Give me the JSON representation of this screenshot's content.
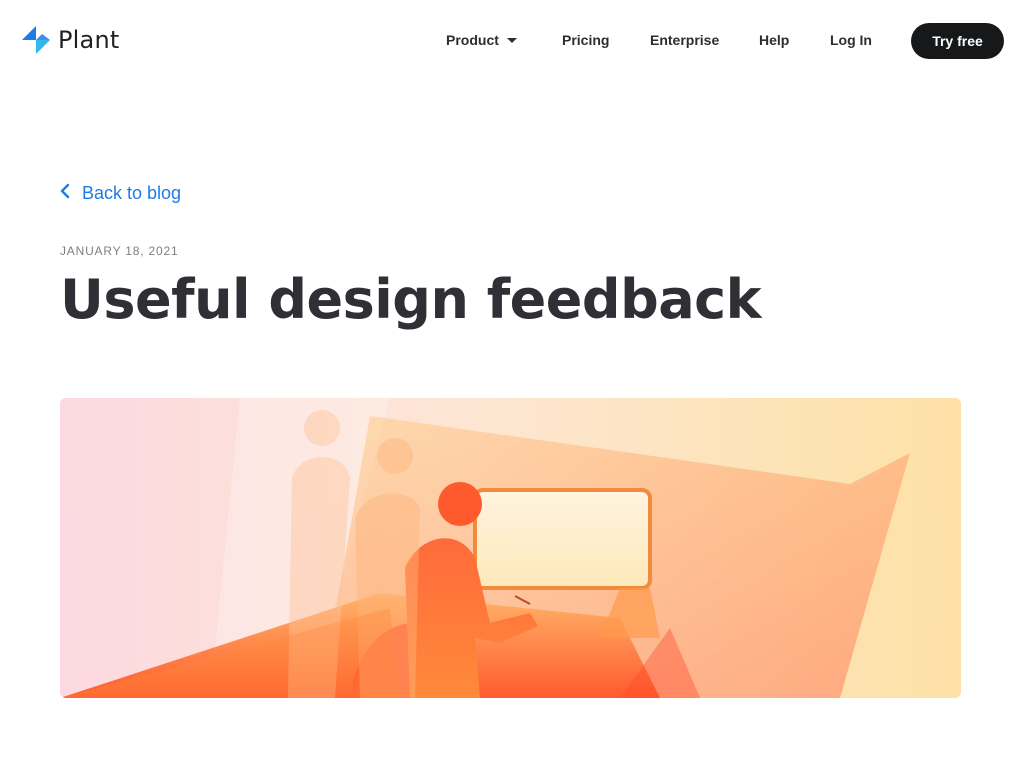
{
  "brand": {
    "name": "Plant",
    "accent": "#1f7be6",
    "logo_colors": [
      "#1f7be6",
      "#34b6f0"
    ]
  },
  "nav": {
    "items": [
      {
        "label": "Product",
        "has_dropdown": true
      },
      {
        "label": "Pricing"
      },
      {
        "label": "Enterprise"
      },
      {
        "label": "Help"
      },
      {
        "label": "Log In"
      }
    ],
    "cta_label": "Try free",
    "cta_color": "#17181a"
  },
  "post": {
    "back_label": "Back to blog",
    "date": "JANUARY 18, 2021",
    "title": "Useful design feedback",
    "hero_image": "illustration-people-reviewing-design-warm-gradient"
  },
  "icons": {
    "logo": "plant-logo-icon",
    "dropdown": "caret-down-icon",
    "back": "chevron-left-icon"
  }
}
